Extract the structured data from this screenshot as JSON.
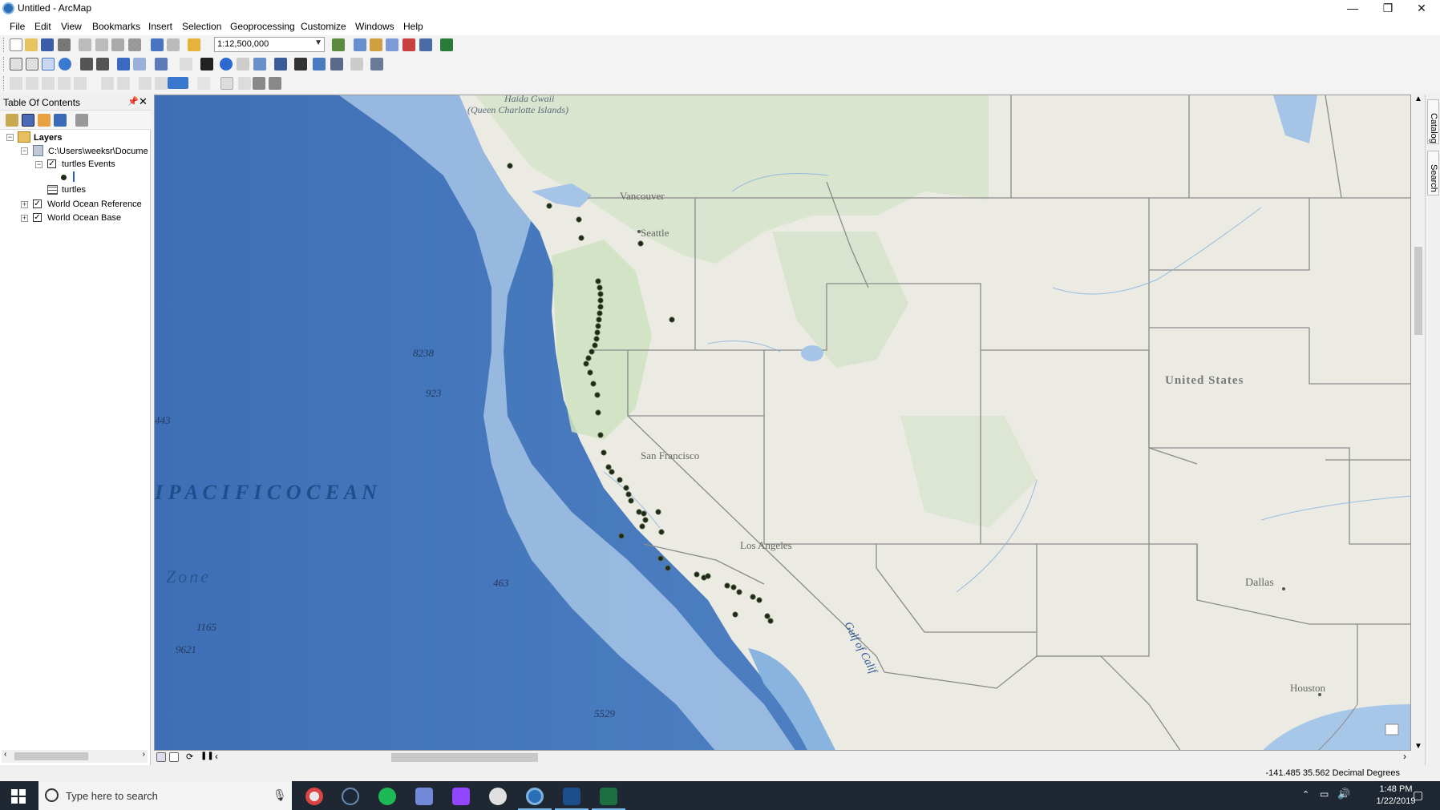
{
  "window": {
    "title": "Untitled - ArcMap",
    "app_icon": "arcmap-icon",
    "controls": {
      "minimize": "—",
      "restore": "❐",
      "close": "✕"
    }
  },
  "menu": {
    "items": [
      "File",
      "Edit",
      "View",
      "Bookmarks",
      "Insert",
      "Selection",
      "Geoprocessing",
      "Customize",
      "Windows",
      "Help"
    ]
  },
  "toolbar": {
    "scale_value": "1:12,500,000"
  },
  "toc": {
    "title": "Table Of Contents",
    "layers_label": "Layers",
    "data_frame_path": "C:\\Users\\weeksr\\Docume",
    "layer_turtles_events": "turtles Events",
    "table_turtles": "turtles",
    "layer_ocean_reference": "World Ocean Reference",
    "layer_ocean_base": "World Ocean Base"
  },
  "map": {
    "labels": {
      "haida": "Haida Gwaii",
      "queen": "(Queen Charlotte Islands)",
      "vancouver": "Vancouver",
      "seattle": "Seattle",
      "san_francisco": "San Francisco",
      "los_angeles": "Los Angeles",
      "dallas": "Dallas",
      "houston": "Houston",
      "united_states": "United States",
      "pacific_ocean": "I   P A C I F I C   O C E A N",
      "zone": "Zone",
      "gulf": "Gulf  of  Calif",
      "d8238": "8238",
      "d923": "923",
      "d443": "443",
      "d463": "463",
      "d1165": "1165",
      "d9621": "9621",
      "d5529": "5529"
    },
    "colors": {
      "ocean_deep": "#4f7fc2",
      "ocean_shelf": "#a9c7e8",
      "land": "#eeede6",
      "forest": "#cfe0c4",
      "points": "#1e2a18",
      "boundary": "#8a8a8a"
    }
  },
  "dock": {
    "catalog": "Catalog",
    "search": "Search"
  },
  "status": {
    "coordinates": "-141.485  35.562 Decimal Degrees"
  },
  "taskbar": {
    "search_placeholder": "Type here to search",
    "time": "1:48 PM",
    "date": "1/22/2019"
  }
}
